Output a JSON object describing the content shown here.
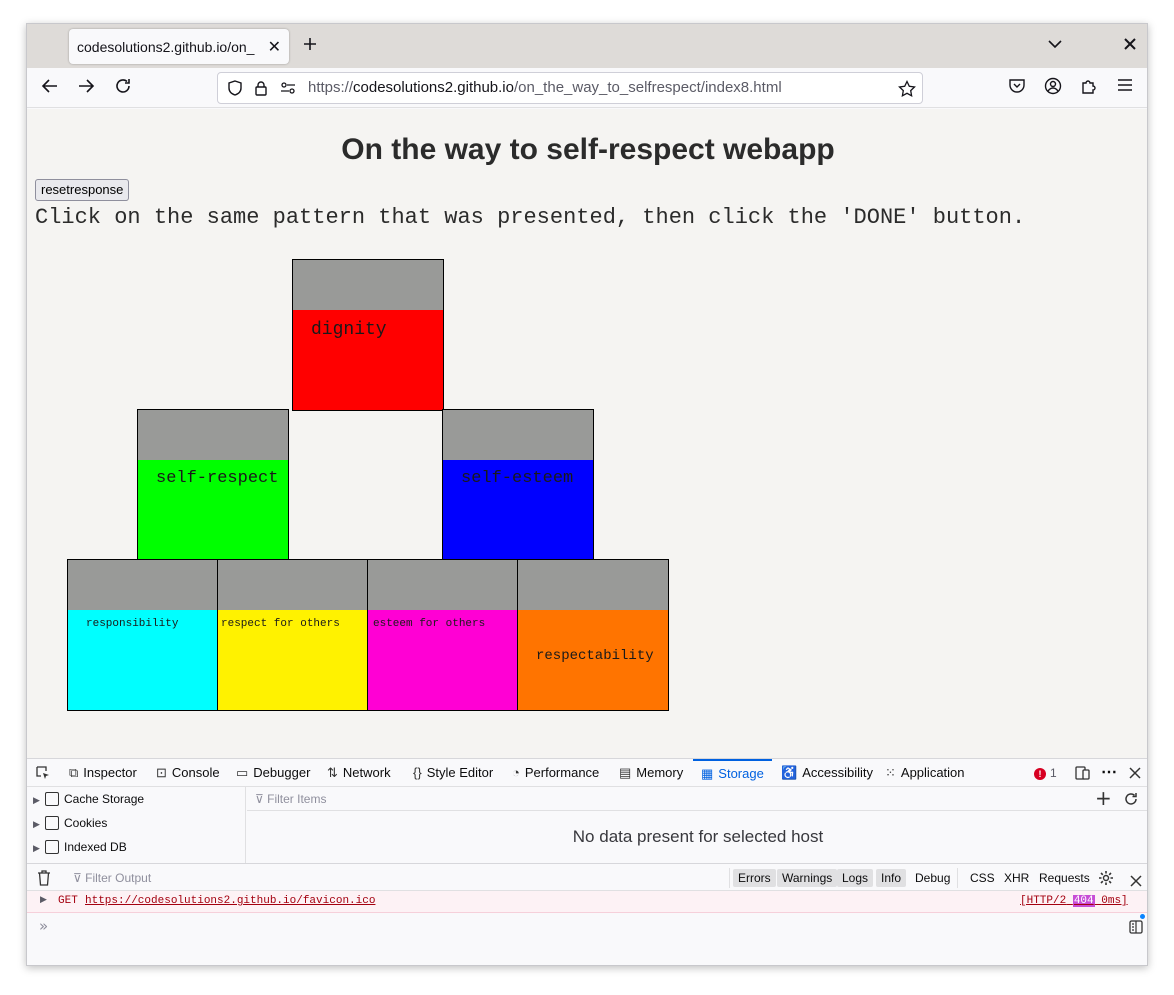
{
  "browser": {
    "tab_title": "codesolutions2.github.io/on_",
    "new_tab_icon": "plus-icon",
    "url_prefix": "https://",
    "url_host": "codesolutions2.github.io",
    "url_path": "/on_the_way_to_selfrespect/index8.html"
  },
  "page": {
    "title": "On the way to self-respect webapp",
    "reset_button": "resetresponse",
    "instructions": "Click on the same pattern that was presented, then click the 'DONE' button.",
    "blocks": [
      {
        "label": "dignity",
        "color": "#ff0000"
      },
      {
        "label": "self-respect",
        "color": "#00ff00"
      },
      {
        "label": "self-esteem",
        "color": "#0000ff"
      },
      {
        "label": "responsibility",
        "color": "#00ffff"
      },
      {
        "label": "respect for others",
        "color": "#fff200"
      },
      {
        "label": "esteem for others",
        "color": "#ff00d4"
      },
      {
        "label": "respectability",
        "color": "#ff7400"
      }
    ],
    "cap_color": "#999a98"
  },
  "devtools": {
    "tabs": [
      "Inspector",
      "Console",
      "Debugger",
      "Network",
      "Style Editor",
      "Performance",
      "Memory",
      "Storage",
      "Accessibility",
      "Application"
    ],
    "active_tab": "Storage",
    "error_count": "1",
    "storage_tree": [
      "Cache Storage",
      "Cookies",
      "Indexed DB"
    ],
    "filter_items_placeholder": "Filter Items",
    "no_data_text": "No data present for selected host",
    "filter_output_placeholder": "Filter Output",
    "console_filters": [
      "Errors",
      "Warnings",
      "Logs",
      "Info",
      "Debug",
      "CSS",
      "XHR",
      "Requests"
    ],
    "console_message": {
      "method": "GET",
      "url": "https://codesolutions2.github.io/favicon.ico",
      "status_prefix": "[HTTP/2",
      "status_code": "404",
      "status_suffix": "0ms]"
    }
  }
}
